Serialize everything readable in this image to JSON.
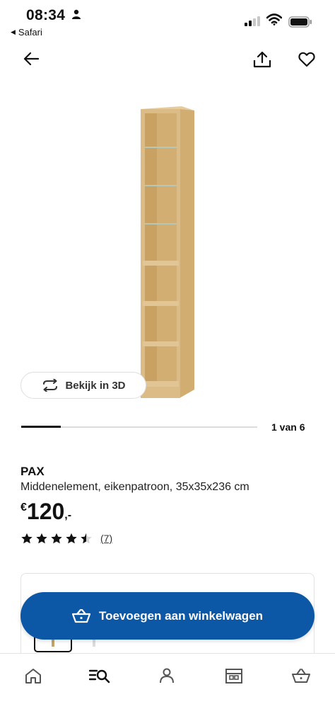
{
  "status_bar": {
    "time": "08:34",
    "back_app": "Safari"
  },
  "nav": {
    "back_icon": "arrow-left-icon",
    "share_icon": "share-icon",
    "favorite_icon": "heart-icon"
  },
  "gallery": {
    "view_3d_label": "Bekijk in 3D",
    "counter": "1 van 6",
    "progress": 0.167
  },
  "product": {
    "name": "PAX",
    "description": "Middenelement, eikenpatroon, 35x35x236 cm",
    "price_currency": "€",
    "price_amount": "120",
    "price_suffix": ",-",
    "rating": 4.5,
    "review_count": "(7)"
  },
  "cart_button": {
    "label": "Toevoegen aan winkelwagen"
  },
  "tabbar": {
    "items": [
      {
        "icon": "home-icon"
      },
      {
        "icon": "search-list-icon"
      },
      {
        "icon": "profile-icon"
      },
      {
        "icon": "store-icon"
      },
      {
        "icon": "basket-icon"
      }
    ]
  },
  "colors": {
    "primary": "#0d58a6",
    "wood": "#d9b987"
  }
}
